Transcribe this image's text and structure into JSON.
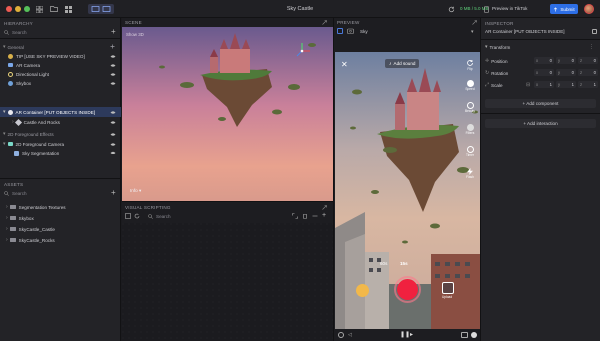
{
  "titlebar": {
    "project_title": "Sky Castle",
    "storage": "0 MB / 5.0 MB",
    "preview_label": "Preview in TikTok",
    "submit_label": "Submit"
  },
  "hierarchy": {
    "title": "HIERARCHY",
    "search_placeholder": "Search",
    "sections": [
      {
        "label": "General"
      },
      {
        "label": "2D Foreground Effects"
      }
    ],
    "items": [
      {
        "label": "TIP [USE SKY PREVIEW VIDEO]"
      },
      {
        "label": "AR Camera"
      },
      {
        "label": "Directional Light"
      },
      {
        "label": "Skybox"
      },
      {
        "label": "AR Container [PUT OBJECTS INSIDE]"
      },
      {
        "label": "Castle And Rocks"
      },
      {
        "label": "2D Foreground Camera"
      },
      {
        "label": "Sky Segmentation"
      }
    ]
  },
  "assets": {
    "title": "ASSETS",
    "search_placeholder": "Search",
    "items": [
      {
        "label": "Segmentation Textures"
      },
      {
        "label": "Skybox"
      },
      {
        "label": "SkyCastle_Castle"
      },
      {
        "label": "SkyCastle_Rocks"
      }
    ]
  },
  "scene": {
    "title": "SCENE",
    "view_label": "Show 3D",
    "info_label": "Info"
  },
  "visual_scripting": {
    "title": "VISUAL SCRIPTING",
    "search_placeholder": "Search"
  },
  "preview": {
    "title": "PREVIEW",
    "source_label": "Sky",
    "add_sound": "Add sound",
    "side_labels": [
      "Flip",
      "Speed",
      "Beauty",
      "Filters",
      "Timer",
      "Flash"
    ],
    "durations": [
      "60s",
      "15s"
    ],
    "upload_label": "Upload"
  },
  "inspector": {
    "title": "INSPECTOR",
    "object_name": "AR Container [PUT OBJECTS INSIDE]",
    "transform_label": "Transform",
    "rows": [
      {
        "label": "Position",
        "x": "0",
        "y": "0",
        "z": "0"
      },
      {
        "label": "Rotation",
        "x": "0",
        "y": "0",
        "z": "0"
      },
      {
        "label": "Scale",
        "x": "1",
        "y": "1",
        "z": "1"
      }
    ],
    "add_component": "+ Add component",
    "add_interaction": "+ Add interaction"
  },
  "colors": {
    "accent": "#2d6ee6",
    "record": "#f0213f",
    "storage_ok": "#5ed17a",
    "selection": "#2d3a5c"
  }
}
